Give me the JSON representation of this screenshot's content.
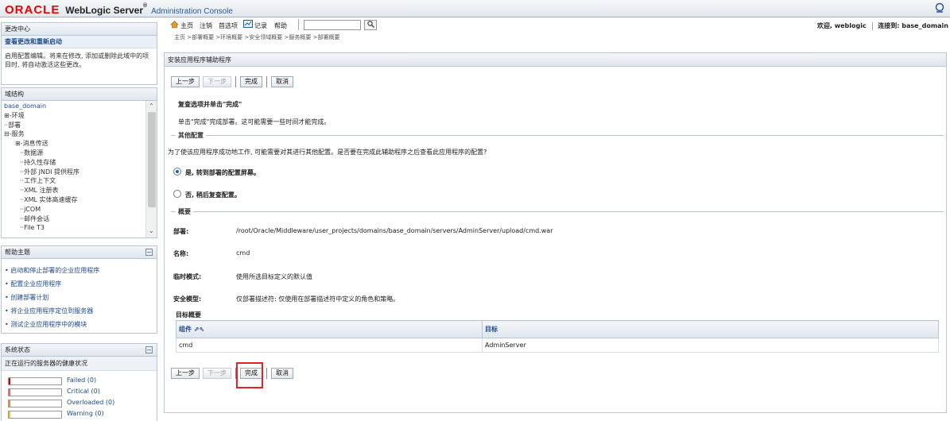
{
  "header": {
    "brand": "ORACLE",
    "product": "WebLogic Server",
    "reg": "®",
    "subtitle": "Administration Console"
  },
  "change_center": {
    "title": "更改中心",
    "link": "查看更改和重新启动",
    "text": "启用配置编辑。将来在修改, 添加或删除此域中的项目时, 将自动激活这些更改。"
  },
  "domain_structure": {
    "title": "域结构",
    "root": "base_domain",
    "items": [
      {
        "label": "⊞-环境",
        "level": 1
      },
      {
        "label": "··部署",
        "level": 1
      },
      {
        "label": "⊟-服务",
        "level": 1
      },
      {
        "label": "⊞-消息传送",
        "level": 2
      },
      {
        "label": "··数据源",
        "level": 3
      },
      {
        "label": "··持久性存储",
        "level": 3
      },
      {
        "label": "··外部 JNDI 提供程序",
        "level": 3
      },
      {
        "label": "··工作上下文",
        "level": 3
      },
      {
        "label": "··XML 注册表",
        "level": 3
      },
      {
        "label": "··XML 实体高速缓存",
        "level": 3
      },
      {
        "label": "··jCOM",
        "level": 3
      },
      {
        "label": "··邮件会话",
        "level": 3
      },
      {
        "label": "··File T3",
        "level": 3
      }
    ]
  },
  "help": {
    "title": "帮助主题",
    "items": [
      "• 启动和停止部署的企业应用程序",
      "• 配置企业应用程序",
      "• 创建部署计划",
      "• 将企业应用程序定位到服务器",
      "• 测试企业应用程序中的模块"
    ]
  },
  "system_status": {
    "title": "系统状态",
    "subtitle": "正在运行的服务器的健康状况",
    "rows": [
      {
        "label": "Failed (0)",
        "color": "#c00000"
      },
      {
        "label": "Critical (0)",
        "color": "#e06666"
      },
      {
        "label": "Overloaded (0)",
        "color": "#e69138"
      },
      {
        "label": "Warning (0)",
        "color": "#f1c232"
      }
    ]
  },
  "toolbar": {
    "home": "主页",
    "logout": "注销",
    "prefs": "首选项",
    "record": "记录",
    "help": "帮助",
    "search_value": "",
    "welcome": "欢迎, weblogic",
    "connected": "连接到: base_domain"
  },
  "breadcrumbs": "主页 >部署概要 >环境概要 >安全领域概要 >服务概要 >部署概要",
  "wizard": {
    "title": "安装应用程序辅助程序",
    "buttons": {
      "back": "上一步",
      "next": "下一步",
      "finish": "完成",
      "cancel": "取消"
    },
    "heading": "复查选项并单击\"完成\"",
    "intro": "单击\"完成\"完成部署。这可能需要一些时间才能完成。",
    "other_config": {
      "caption": "其他配置",
      "question": "为了使该应用程序成功地工作, 可能需要对其进行其他配置。是否要在完成此辅助程序之后查看此应用程序的配置?",
      "option_yes": "是, 转到部署的配置屏幕。",
      "option_no": "否, 稍后复查配置。",
      "selected": "yes"
    },
    "summary": {
      "caption": "概要",
      "deployment_label": "部署:",
      "deployment_value": "/root/Oracle/Middleware/user_projects/domains/base_domain/servers/AdminServer/upload/cmd.war",
      "name_label": "名称:",
      "name_value": "cmd",
      "staging_label": "临时模式:",
      "staging_value": "使用所选目标定义的默认值",
      "security_label": "安全模型:",
      "security_value": "仅部署描述符: 仅使用在部署描述符中定义的角色和策略。",
      "targets_label": "目标概要"
    },
    "table": {
      "headers": [
        "组件 ⇗⇖",
        "目标"
      ],
      "rows": [
        [
          "cmd",
          "AdminServer"
        ]
      ]
    }
  }
}
